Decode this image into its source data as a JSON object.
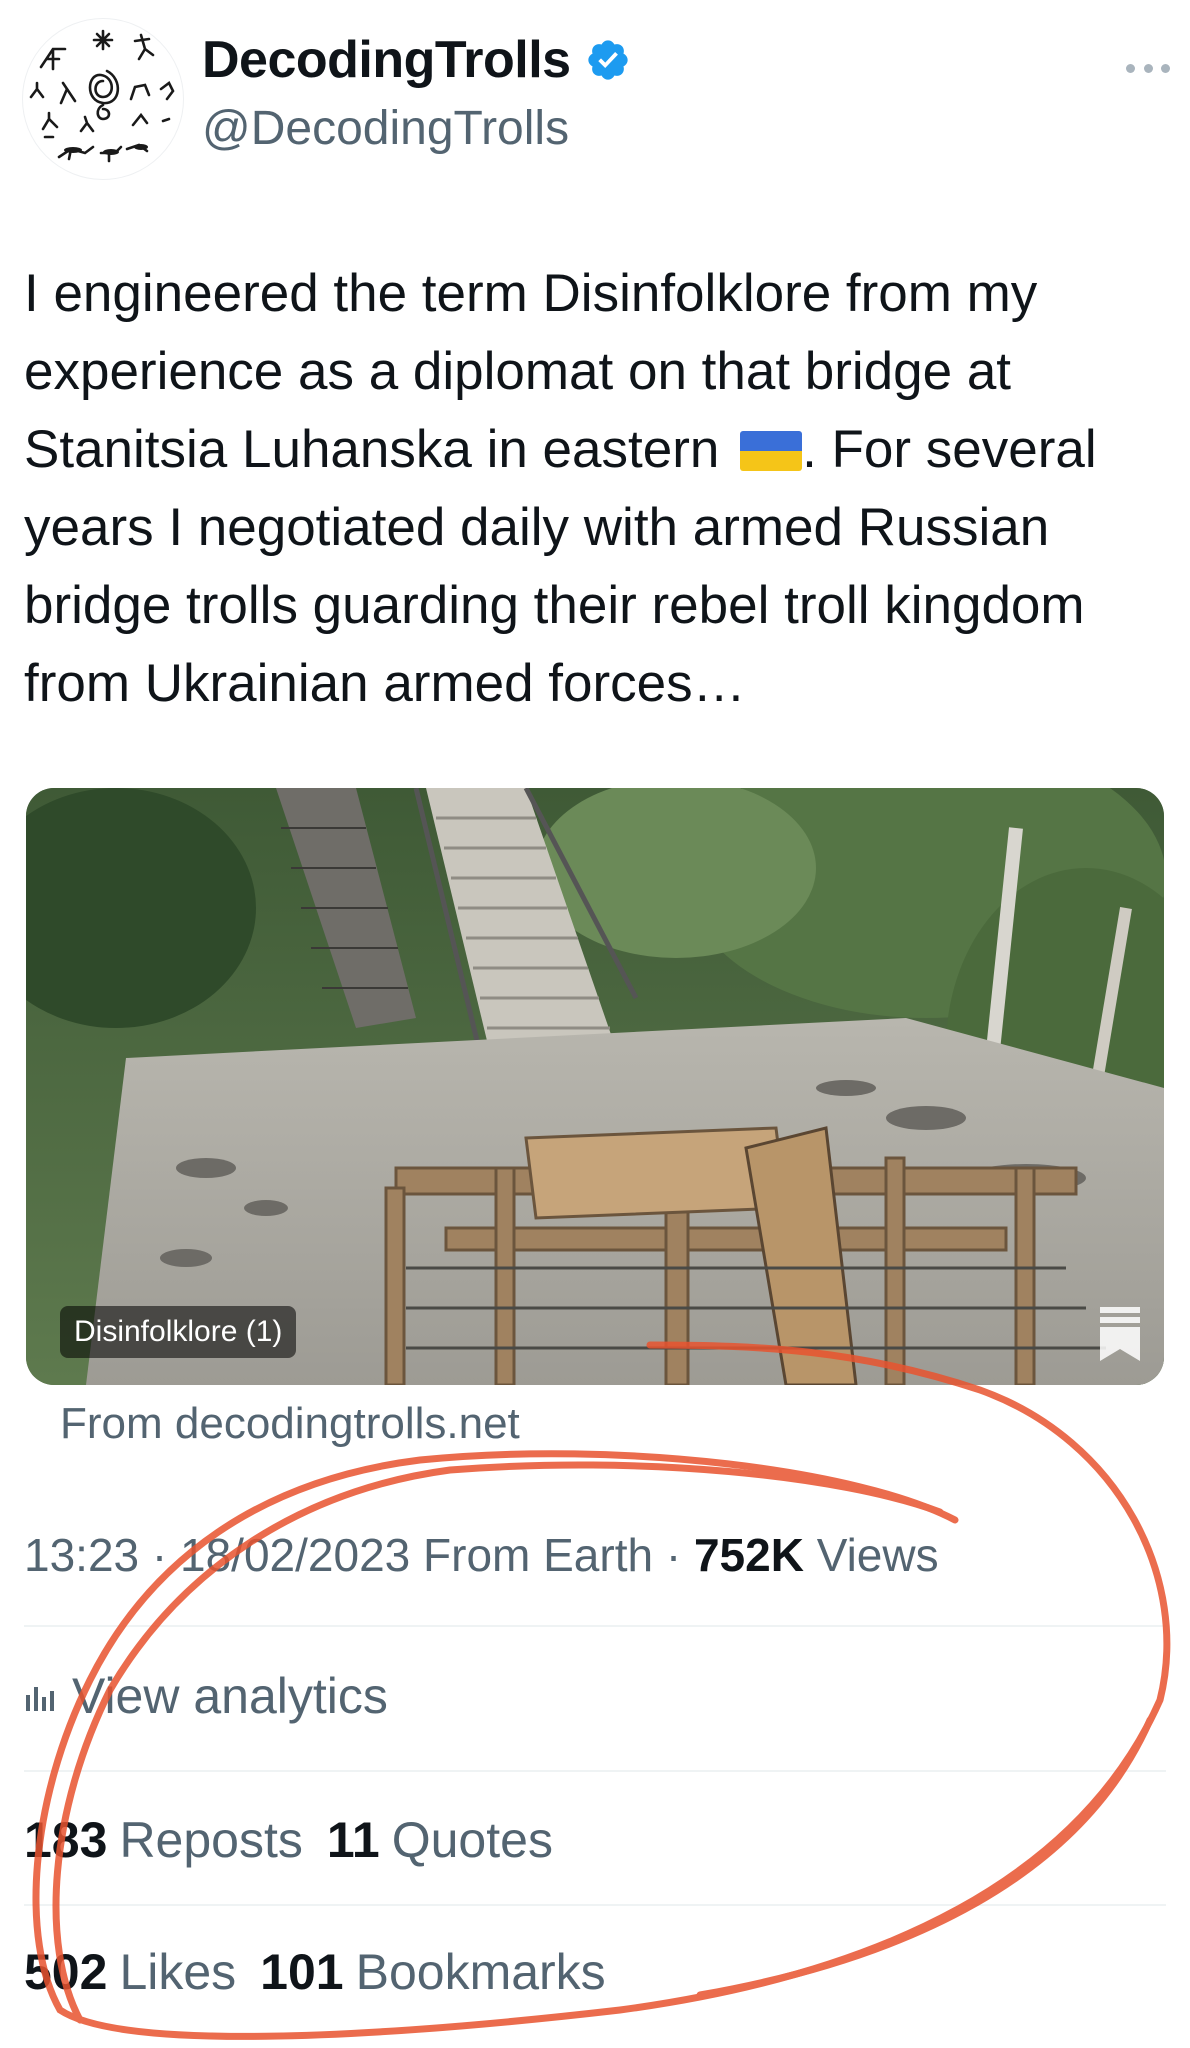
{
  "author": {
    "display_name": "DecodingTrolls",
    "handle": "@DecodingTrolls",
    "verified": true,
    "avatar_icon": "troll-glyphs-avatar-icon"
  },
  "tweet": {
    "text_before_flag": "I engineered the term Disinfolklore from my experience as a diplomat on that bridge at Stanitsia Luhanska in eastern ",
    "flag_emoji": "ukraine-flag-icon",
    "text_after_flag": ". For several years I negotiated daily with armed Russian bridge trolls guarding their rebel troll kingdom from Ukrainian armed forces…"
  },
  "media": {
    "tag_label": "Disinfolklore (1)",
    "description": "bridge-photo",
    "source": "From decodingtrolls.net"
  },
  "meta": {
    "time": "13:23",
    "separator": "·",
    "date": "18/02/2023",
    "client": "From Earth",
    "views_count": "752K",
    "views_label": "Views"
  },
  "analytics": {
    "label": "View analytics"
  },
  "stats": {
    "reposts_count": "183",
    "reposts_label": "Reposts",
    "quotes_count": "11",
    "quotes_label": "Quotes",
    "likes_count": "502",
    "likes_label": "Likes",
    "bookmarks_count": "101",
    "bookmarks_label": "Bookmarks"
  },
  "colors": {
    "text_primary": "#0f1419",
    "text_secondary": "#536471",
    "verified_blue": "#1d9bf0",
    "scribble_red": "#e8532f",
    "divider": "#eff3f4"
  }
}
